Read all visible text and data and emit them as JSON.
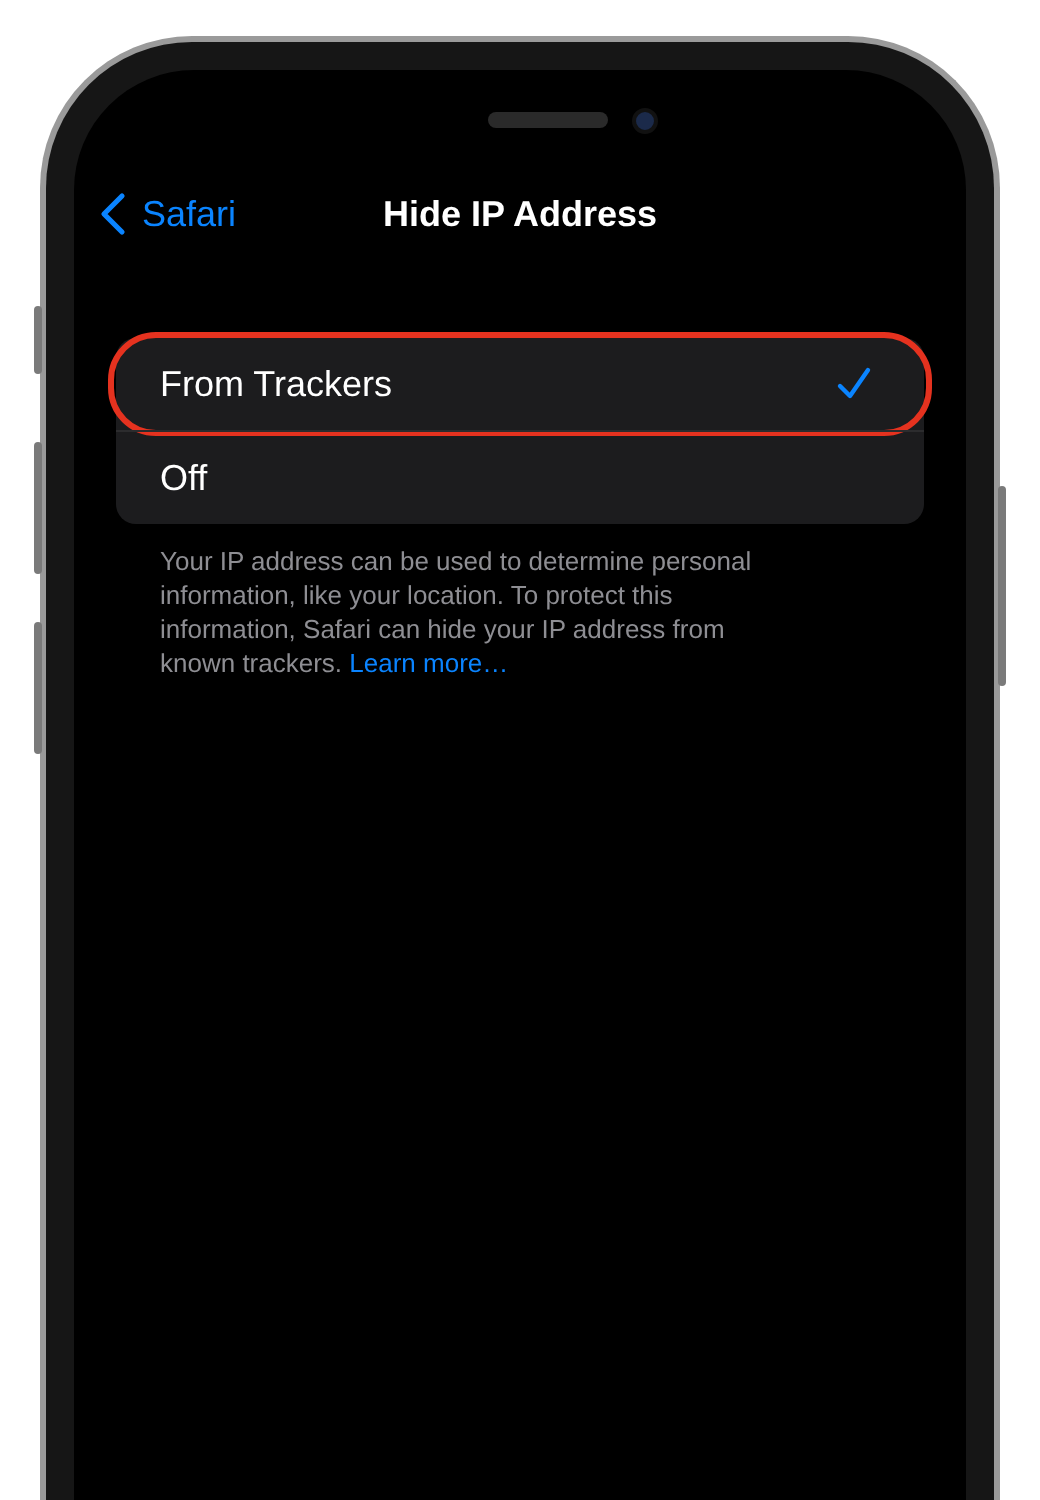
{
  "nav": {
    "back": "Safari",
    "title": "Hide IP Address"
  },
  "options": [
    {
      "label": "From Trackers",
      "selected": true,
      "highlighted": true
    },
    {
      "label": "Off",
      "selected": false,
      "highlighted": false
    }
  ],
  "footer": {
    "text": "Your IP address can be used to determine personal information, like your location. To protect this information, Safari can hide your IP address from known trackers.",
    "link": "Learn more…"
  }
}
